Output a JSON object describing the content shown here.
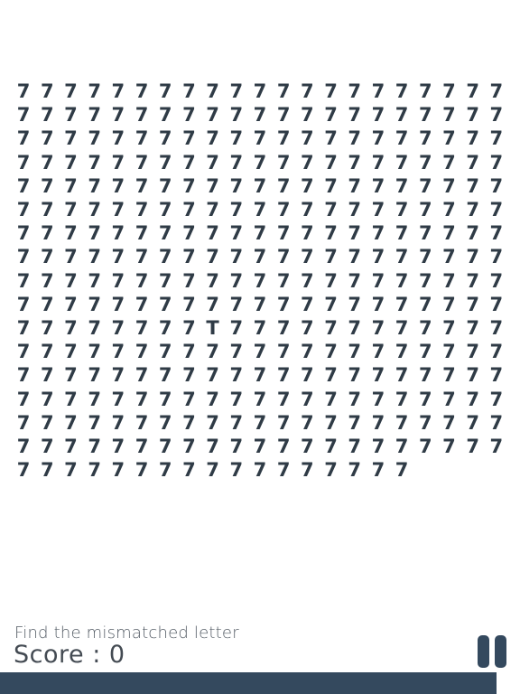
{
  "game": {
    "base_char": "7",
    "odd_char": "T",
    "total_cells": 353,
    "odd_index": 218
  },
  "instruction": "Find the mismatched letter",
  "score_text": "Score : 0",
  "pause_icon": "pause-icon",
  "timer": {
    "remaining_fraction": 0.955
  },
  "colors": {
    "text": "#2f3b46",
    "accent": "#34495e"
  }
}
